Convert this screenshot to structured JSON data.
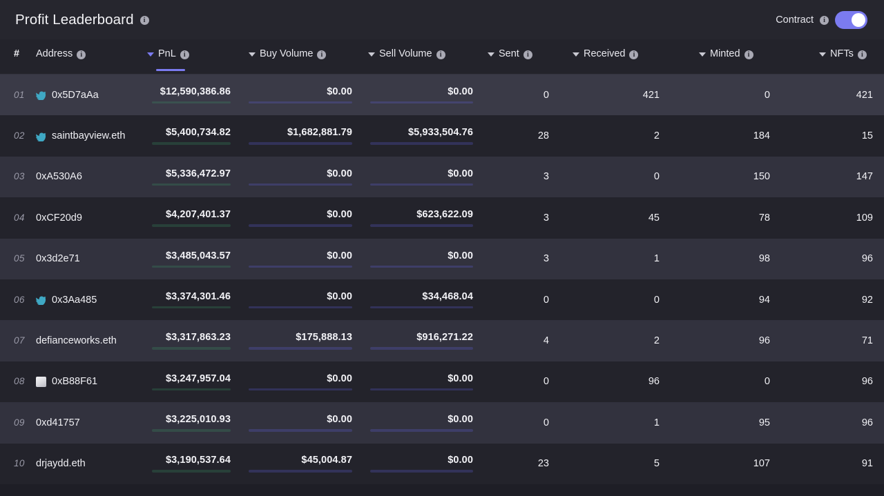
{
  "header": {
    "title": "Profit Leaderboard",
    "title_info_icon": "info-icon",
    "contract_label": "Contract",
    "contract_info_icon": "info-icon",
    "contract_toggle_state": "on",
    "accent_color": "#7b7bf0"
  },
  "columns": [
    {
      "key": "rank",
      "label": "#",
      "sortable": false,
      "active": false,
      "info": false
    },
    {
      "key": "addr",
      "label": "Address",
      "sortable": false,
      "active": false,
      "info": true
    },
    {
      "key": "pnl",
      "label": "PnL",
      "sortable": true,
      "active": true,
      "info": true
    },
    {
      "key": "buy",
      "label": "Buy Volume",
      "sortable": true,
      "active": false,
      "info": true
    },
    {
      "key": "sell",
      "label": "Sell Volume",
      "sortable": true,
      "active": false,
      "info": true
    },
    {
      "key": "sent",
      "label": "Sent",
      "sortable": true,
      "active": false,
      "info": true
    },
    {
      "key": "recv",
      "label": "Received",
      "sortable": true,
      "active": false,
      "info": true
    },
    {
      "key": "mint",
      "label": "Minted",
      "sortable": true,
      "active": false,
      "info": true
    },
    {
      "key": "nfts",
      "label": "NFTs",
      "sortable": true,
      "active": false,
      "info": true
    }
  ],
  "scales": {
    "pnl_max": 12590386.86,
    "buy_max": 2500000,
    "sell_max": 6300000
  },
  "colors": {
    "pnl_bar": "#3ea46b",
    "volume_bar": "#4b4bd9",
    "accent": "#7b7bf0",
    "row_odd": "#32323e",
    "row_even": "#23232b",
    "row_highlight": "#3a3a47",
    "page_bg": "#1e1e26",
    "topbar_bg": "#26262e"
  },
  "rows": [
    {
      "rank": "01",
      "avatar": "bird-icon",
      "address": "0x5D7aAa",
      "pnl": "$12,590,386.86",
      "pnl_value": 12590386.86,
      "buy": "$0.00",
      "buy_value": 0,
      "sell": "$0.00",
      "sell_value": 0,
      "sent": "0",
      "received": "421",
      "minted": "0",
      "nfts": "421",
      "highlight": true
    },
    {
      "rank": "02",
      "avatar": "bird-icon",
      "address": "saintbayview.eth",
      "pnl": "$5,400,734.82",
      "pnl_value": 5400734.82,
      "buy": "$1,682,881.79",
      "buy_value": 1682881.79,
      "sell": "$5,933,504.76",
      "sell_value": 5933504.76,
      "sent": "28",
      "received": "2",
      "minted": "184",
      "nfts": "15",
      "highlight": false
    },
    {
      "rank": "03",
      "avatar": null,
      "address": "0xA530A6",
      "pnl": "$5,336,472.97",
      "pnl_value": 5336472.97,
      "buy": "$0.00",
      "buy_value": 0,
      "sell": "$0.00",
      "sell_value": 0,
      "sent": "3",
      "received": "0",
      "minted": "150",
      "nfts": "147",
      "highlight": false
    },
    {
      "rank": "04",
      "avatar": null,
      "address": "0xCF20d9",
      "pnl": "$4,207,401.37",
      "pnl_value": 4207401.37,
      "buy": "$0.00",
      "buy_value": 0,
      "sell": "$623,622.09",
      "sell_value": 623622.09,
      "sent": "3",
      "received": "45",
      "minted": "78",
      "nfts": "109",
      "highlight": false
    },
    {
      "rank": "05",
      "avatar": null,
      "address": "0x3d2e71",
      "pnl": "$3,485,043.57",
      "pnl_value": 3485043.57,
      "buy": "$0.00",
      "buy_value": 0,
      "sell": "$0.00",
      "sell_value": 0,
      "sent": "3",
      "received": "1",
      "minted": "98",
      "nfts": "96",
      "highlight": false
    },
    {
      "rank": "06",
      "avatar": "bird-icon",
      "address": "0x3Aa485",
      "pnl": "$3,374,301.46",
      "pnl_value": 3374301.46,
      "buy": "$0.00",
      "buy_value": 0,
      "sell": "$34,468.04",
      "sell_value": 34468.04,
      "sent": "0",
      "received": "0",
      "minted": "94",
      "nfts": "92",
      "highlight": false
    },
    {
      "rank": "07",
      "avatar": null,
      "address": "defianceworks.eth",
      "pnl": "$3,317,863.23",
      "pnl_value": 3317863.23,
      "buy": "$175,888.13",
      "buy_value": 175888.13,
      "sell": "$916,271.22",
      "sell_value": 916271.22,
      "sent": "4",
      "received": "2",
      "minted": "96",
      "nfts": "71",
      "highlight": false
    },
    {
      "rank": "08",
      "avatar": "square-icon",
      "address": "0xB88F61",
      "pnl": "$3,247,957.04",
      "pnl_value": 3247957.04,
      "buy": "$0.00",
      "buy_value": 0,
      "sell": "$0.00",
      "sell_value": 0,
      "sent": "0",
      "received": "96",
      "minted": "0",
      "nfts": "96",
      "highlight": false
    },
    {
      "rank": "09",
      "avatar": null,
      "address": "0xd41757",
      "pnl": "$3,225,010.93",
      "pnl_value": 3225010.93,
      "buy": "$0.00",
      "buy_value": 0,
      "sell": "$0.00",
      "sell_value": 0,
      "sent": "0",
      "received": "1",
      "minted": "95",
      "nfts": "96",
      "highlight": false
    },
    {
      "rank": "10",
      "avatar": null,
      "address": "drjaydd.eth",
      "pnl": "$3,190,537.64",
      "pnl_value": 3190537.64,
      "buy": "$45,004.87",
      "buy_value": 45004.87,
      "sell": "$0.00",
      "sell_value": 0,
      "sent": "23",
      "received": "5",
      "minted": "107",
      "nfts": "91",
      "highlight": false
    }
  ]
}
